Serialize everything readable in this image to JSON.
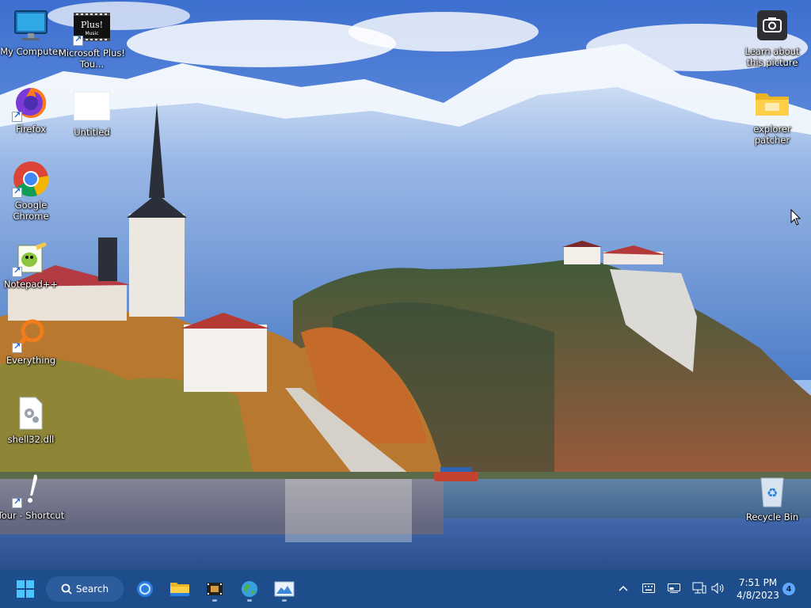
{
  "desktop": {
    "icons": {
      "my_computer": "My Computer",
      "plus": "Microsoft Plus! Tou...",
      "plus_badge": "Plus!",
      "plus_badge2": "Music",
      "firefox": "Firefox",
      "untitled": "Untitled",
      "chrome": "Google Chrome",
      "notepadpp": "Notepad++",
      "everything": "Everything",
      "shell32": "shell32.dll",
      "tour": "Tour - Shortcut",
      "learn": "Learn about this picture",
      "explorer_patcher": "explorer patcher",
      "recycle": "Recycle Bin"
    }
  },
  "taskbar": {
    "search_label": "Search",
    "time": "7:51 PM",
    "date": "4/8/2023",
    "notification_count": "4",
    "pinned": [
      "start-icon",
      "cortana-icon",
      "file-explorer-icon",
      "movie-maker-icon",
      "globe-icon",
      "photos-icon"
    ],
    "tray_icons": [
      "chevron-up-icon",
      "keyboard-icon",
      "display-icon",
      "network-icon",
      "volume-icon"
    ]
  },
  "colors": {
    "taskbar_bg": "#1e4d8c",
    "search_bg": "#2c5c9c",
    "accent": "#5fa8ff"
  }
}
